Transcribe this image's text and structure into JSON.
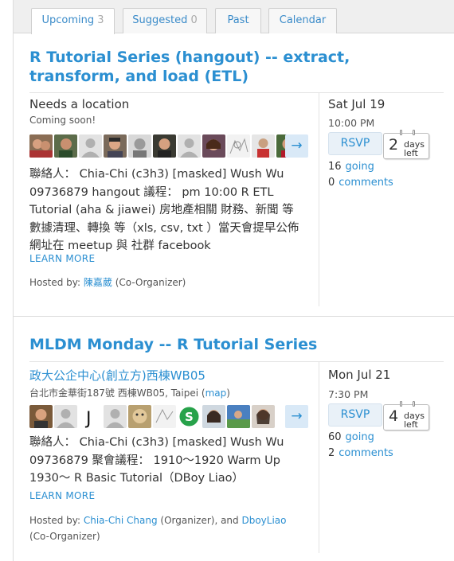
{
  "tabs": [
    {
      "label": "Upcoming",
      "count": "3"
    },
    {
      "label": "Suggested",
      "count": "0"
    },
    {
      "label": "Past",
      "count": ""
    },
    {
      "label": "Calendar",
      "count": ""
    }
  ],
  "events": [
    {
      "title": "R Tutorial Series (hangout) -- extract, transform, and load (ETL)",
      "venue": "Needs a location",
      "venue_sub": "Coming soon!",
      "description": "聯絡人： Chia-Chi (c3h3) [masked] Wush Wu 09736879 hangout 議程： pm 10:00 R ETL Tutorial (aha & jiawei) 房地產相關 財務、新聞 等數據清理、轉換 等（xls, csv, txt ）當天會提早公佈網址在 meetup 與 社群 facebook",
      "learn_more": "LEARN MORE",
      "hosted_prefix": "Hosted by:",
      "host1": "陳嘉葳",
      "host1_role": "(Co-Organizer)",
      "date": "Sat Jul 19",
      "time": "10:00 PM",
      "rsvp": "RSVP",
      "days_left": "2",
      "days_label1": "days",
      "days_label2": "left",
      "going_count": "16",
      "going_label": "going",
      "comments_count": "0",
      "comments_label": "comments"
    },
    {
      "title": "MLDM Monday -- R Tutorial Series",
      "venue": "政大公企中心(創立方)西棟WB05",
      "venue_sub": "台北市金華街187號 西棟WB05, Taipei (",
      "map_link": "map",
      "venue_sub_end": ")",
      "description": "聯絡人： Chia-Chi (c3h3) [masked] Wush Wu 09736879 聚會議程： 1910～1920 Warm Up 1930～ R Basic Tutorial（DBoy Liao）",
      "learn_more": "LEARN MORE",
      "hosted_prefix": "Hosted by:",
      "host1": "Chia-Chi Chang",
      "host1_role": "(Organizer), and",
      "host2": "DboyLiao",
      "host2_role": "(Co-Organizer)",
      "date": "Mon Jul 21",
      "time": "7:30 PM",
      "rsvp": "RSVP",
      "days_left": "4",
      "days_label1": "days",
      "days_label2": "left",
      "going_count": "60",
      "going_label": "going",
      "comments_count": "2",
      "comments_label": "comments"
    }
  ],
  "avatar_arrow": "→",
  "colors": {
    "link": "#2b8fd1",
    "tab_bg": "#efefef",
    "rsvp_bg": "#e9f1f8"
  }
}
